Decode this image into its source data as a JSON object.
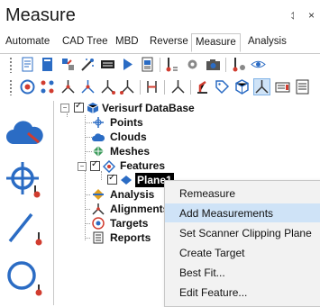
{
  "panel": {
    "title": "Measure",
    "pin_icon": "⥑",
    "close_icon": "×"
  },
  "tabs": [
    "Automate",
    "CAD Tree",
    "MBD",
    "Reverse",
    "Measure",
    "Analysis"
  ],
  "active_tab": "Measure",
  "tree": {
    "root": "Verisurf DataBase",
    "items": [
      "Points",
      "Clouds",
      "Meshes",
      "Features",
      "Plane1",
      "Analysis",
      "Alignments",
      "Targets",
      "Reports"
    ],
    "selected": "Plane1"
  },
  "context_menu": {
    "items": [
      "Remeasure",
      "Add Measurements",
      "Set Scanner Clipping Plane",
      "Create Target",
      "Best Fit...",
      "Edit Feature..."
    ],
    "highlighted": "Add Measurements"
  },
  "colors": {
    "accent": "#2b6cc4",
    "selection": "#cfe3f7",
    "red": "#d13c2f"
  }
}
